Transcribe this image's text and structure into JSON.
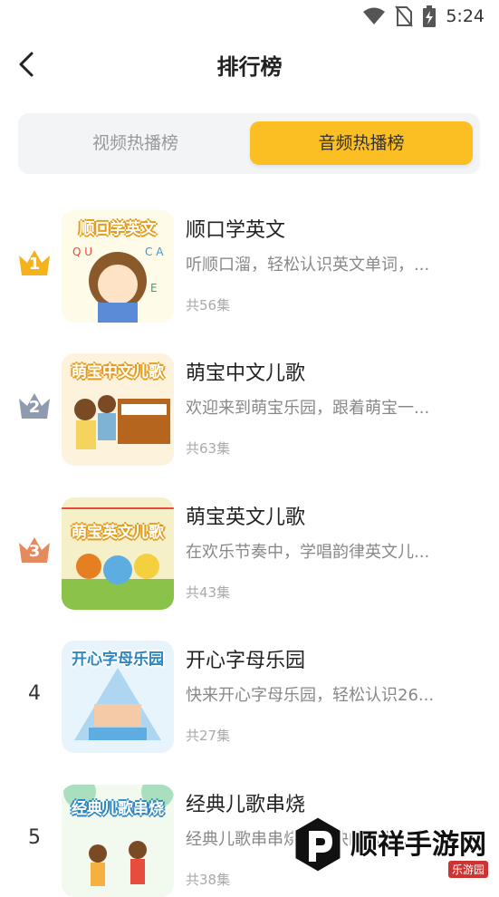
{
  "status_bar": {
    "time": "5:24"
  },
  "header": {
    "title": "排行榜"
  },
  "tabs": [
    {
      "label": "视频热播榜",
      "active": false
    },
    {
      "label": "音频热播榜",
      "active": true
    }
  ],
  "items": [
    {
      "rank": "1",
      "thumb_text": "顺口学英文",
      "title": "顺口学英文",
      "desc": "听顺口溜，轻松认识英文单词，...",
      "count": "共56集"
    },
    {
      "rank": "2",
      "thumb_text": "萌宝中文儿歌",
      "title": "萌宝中文儿歌",
      "desc": "欢迎来到萌宝乐园，跟着萌宝一...",
      "count": "共63集"
    },
    {
      "rank": "3",
      "thumb_text": "萌宝英文儿歌",
      "title": "萌宝英文儿歌",
      "desc": "在欢乐节奏中，学唱韵律英文儿...",
      "count": "共43集"
    },
    {
      "rank": "4",
      "thumb_text": "开心字母乐园",
      "title": "开心字母乐园",
      "desc": "快来开心字母乐园，轻松认识26...",
      "count": "共27集"
    },
    {
      "rank": "5",
      "thumb_text": "经典儿歌串烧",
      "title": "经典儿歌串烧",
      "desc": "经典儿歌串串烧，欢快的歌曲...",
      "count": "共38集"
    }
  ],
  "watermark": {
    "text": "顺祥手游网",
    "sub": "乐游园"
  },
  "colors": {
    "accent": "#fbbf24",
    "gold": "#f5b21a",
    "silver": "#8e9aaf",
    "bronze": "#e58a5c"
  }
}
